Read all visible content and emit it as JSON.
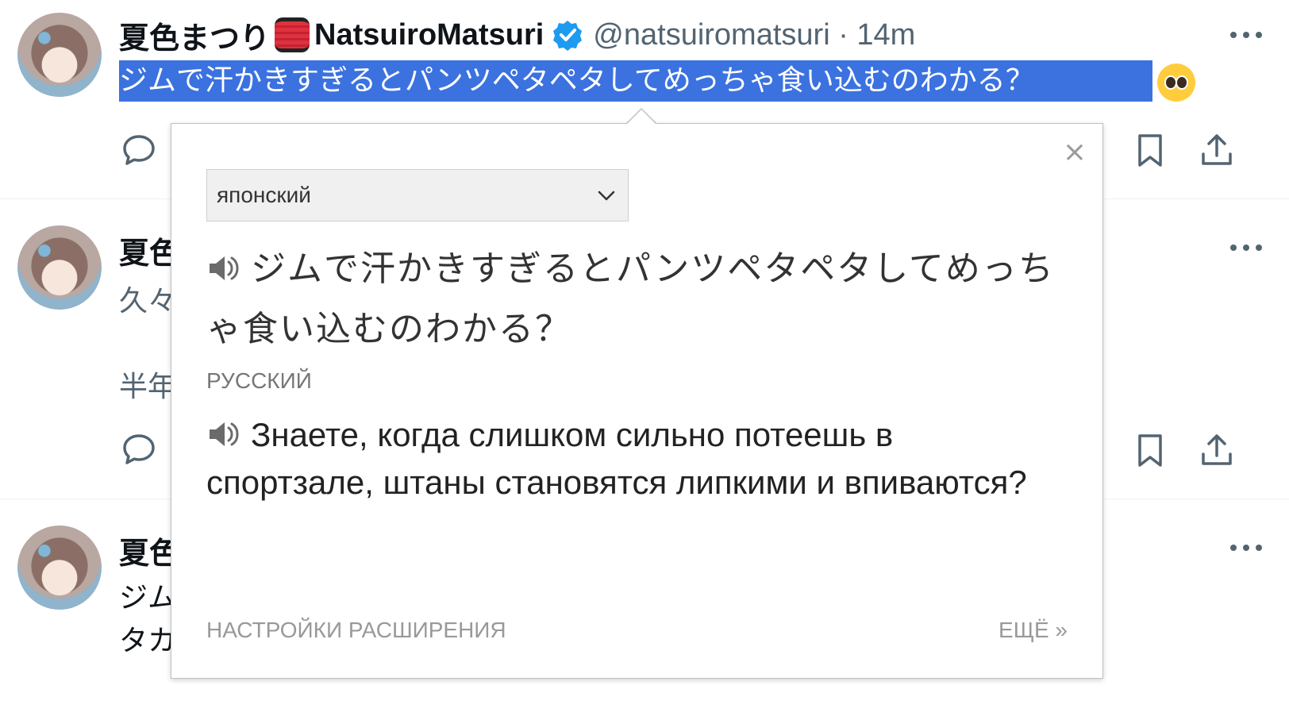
{
  "tweet1": {
    "name_jp": "夏色まつり",
    "name_latin": "NatsuiroMatsuri",
    "handle_time": "@natsuiromatsuri · 14m",
    "text": "ジムで汗かきすぎるとパンツペタペタしてめっちゃ食い込むのわかる？"
  },
  "tweet2": {
    "name_partial": "夏色",
    "line1_partial": "久々",
    "line2_partial": "半年"
  },
  "tweet3": {
    "name_partial": "夏色",
    "line1_partial": "ジム",
    "line2_partial": "タカ"
  },
  "popup": {
    "close_label": "×",
    "source_language": "японский",
    "source_text": "ジムで汗かきすぎるとパンツペタペタしてめっちゃ食い込むのわかる？",
    "target_language_label": "РУССКИЙ",
    "target_text": "Знаете, когда слишком сильно потеешь в спортзале, штаны становятся липкими и впиваются?",
    "settings_link": "НАСТРОЙКИ РАСШИРЕНИЯ",
    "more_link": "ЕЩЁ »"
  },
  "icons": {
    "reply": "reply-icon",
    "bookmark": "bookmark-icon",
    "share": "share-icon",
    "more": "more-icon",
    "speaker": "speaker-icon",
    "verified": "verified-badge-icon",
    "chevron": "chevron-down-icon"
  },
  "colors": {
    "selection": "#3b72e0",
    "verified": "#1d9bf0",
    "icon_gray": "#536471"
  }
}
